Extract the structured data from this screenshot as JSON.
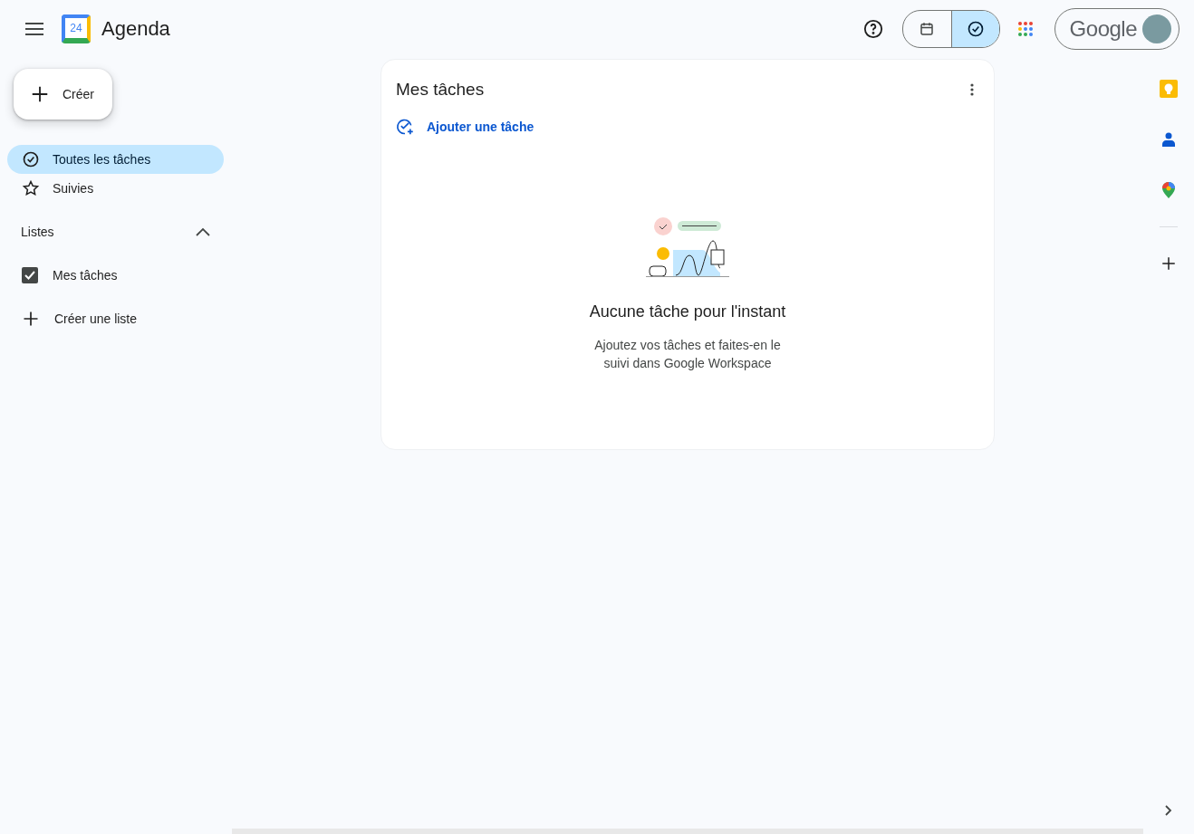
{
  "header": {
    "logo_day": "24",
    "title": "Agenda",
    "view_toggle": [
      {
        "kind": "calendar",
        "selected": false
      },
      {
        "kind": "tasks",
        "selected": true
      }
    ],
    "account_wordmark": "Google"
  },
  "sidebar": {
    "create_button": "Créer",
    "nav": [
      {
        "kind": "all",
        "label": "Toutes les tâches",
        "selected": true
      },
      {
        "kind": "starred",
        "label": "Suivies",
        "selected": false
      }
    ],
    "lists_heading": "Listes",
    "lists_expanded": true,
    "lists": [
      {
        "label": "Mes tâches",
        "checked": true
      }
    ],
    "create_list": "Créer une liste"
  },
  "task_panel": {
    "title": "Mes tâches",
    "add_task": "Ajouter une tâche",
    "empty_title": "Aucune tâche pour l'instant",
    "empty_text": "Ajoutez vos tâches et faites-en le suivi dans Google Workspace"
  },
  "side_panel": {
    "apps": [
      {
        "kind": "keep"
      },
      {
        "kind": "contacts"
      },
      {
        "kind": "maps"
      }
    ]
  }
}
